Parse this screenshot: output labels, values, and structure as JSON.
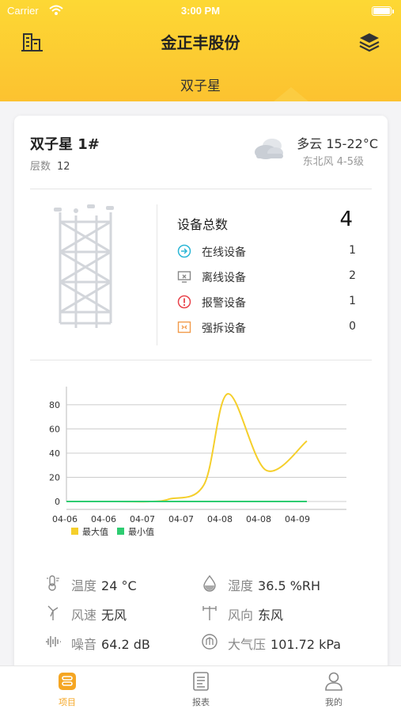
{
  "status": {
    "carrier": "Carrier",
    "time": "3:00 PM"
  },
  "nav": {
    "title": "金正丰股份",
    "subtitle": "双子星"
  },
  "tower": {
    "name": "双子星 1#",
    "floors_label": "层数",
    "floors_value": "12",
    "weather": "多云 15-22°C",
    "wind": "东北风 4-5级"
  },
  "devices": {
    "total_label": "设备总数",
    "total_value": "4",
    "items": [
      {
        "label": "在线设备",
        "value": "1",
        "icon": "online-icon",
        "color": "#2bb6d6"
      },
      {
        "label": "离线设备",
        "value": "2",
        "icon": "offline-icon",
        "color": "#888888"
      },
      {
        "label": "报警设备",
        "value": "1",
        "icon": "alarm-icon",
        "color": "#e8434b"
      },
      {
        "label": "强拆设备",
        "value": "0",
        "icon": "dismantle-icon",
        "color": "#f29b4b"
      }
    ]
  },
  "chart_data": {
    "type": "line",
    "x": [
      "04-06",
      "04-06",
      "04-07",
      "04-07",
      "04-08",
      "04-08",
      "04-09"
    ],
    "ylim": [
      0,
      95
    ],
    "yticks": [
      0,
      20,
      40,
      60,
      80
    ],
    "legend_position": "bottom-left",
    "grid": true,
    "series": [
      {
        "name": "最大值",
        "color": "#f5cf2b",
        "values": [
          0,
          0,
          0,
          2,
          14,
          89,
          26,
          50
        ]
      },
      {
        "name": "最小值",
        "color": "#2ecc71",
        "values": [
          0,
          0,
          0,
          0,
          0,
          0,
          0,
          0
        ]
      }
    ]
  },
  "metrics": [
    {
      "label": "温度",
      "value": "24 °C",
      "icon": "thermometer-icon"
    },
    {
      "label": "湿度",
      "value": "36.5 %RH",
      "icon": "humidity-icon"
    },
    {
      "label": "风速",
      "value": "无风",
      "icon": "wind-speed-icon"
    },
    {
      "label": "风向",
      "value": "东风",
      "icon": "wind-direction-icon"
    },
    {
      "label": "噪音",
      "value": "64.2 dB",
      "icon": "noise-icon"
    },
    {
      "label": "大气压",
      "value": "101.72 kPa",
      "icon": "pressure-icon"
    }
  ],
  "tabs": [
    {
      "label": "项目",
      "icon": "project-icon",
      "active": true
    },
    {
      "label": "报表",
      "icon": "report-icon",
      "active": false
    },
    {
      "label": "我的",
      "icon": "profile-icon",
      "active": false
    }
  ],
  "colors": {
    "accent": "#f5a623",
    "header": "#fcc230"
  }
}
